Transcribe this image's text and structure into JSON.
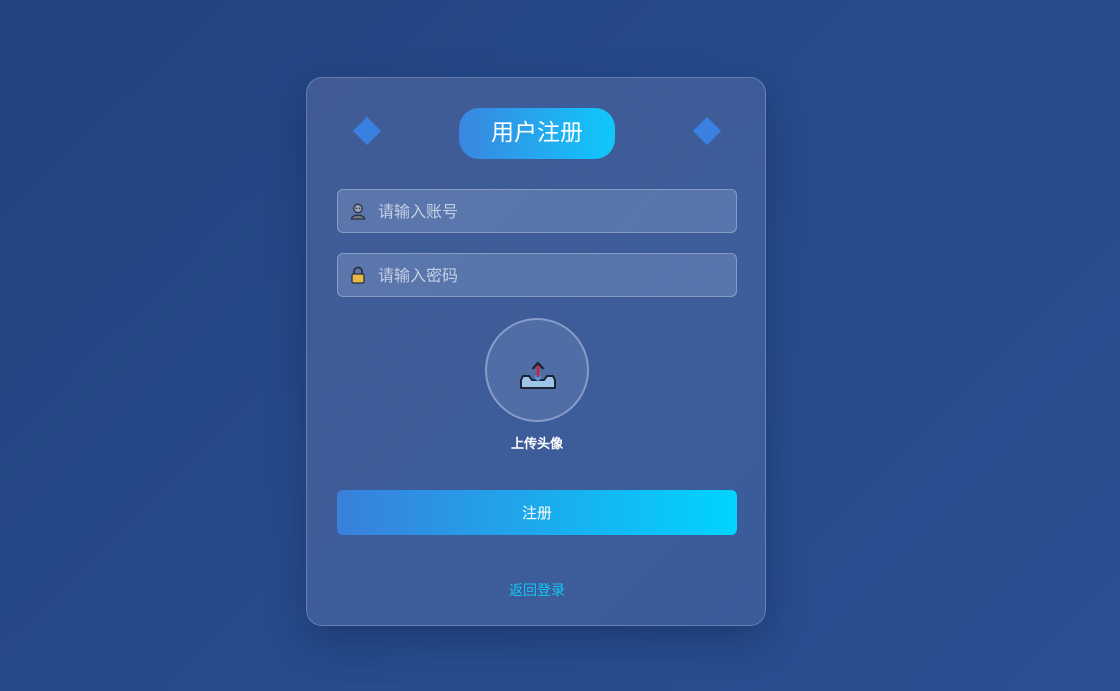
{
  "form": {
    "title": "用户注册",
    "account_placeholder": "请输入账号",
    "password_placeholder": "请输入密码",
    "upload_label": "上传头像",
    "register_label": "注册",
    "back_link": "返回登录"
  },
  "icons": {
    "account": "user-icon",
    "password": "lock-icon",
    "upload": "upload-icon",
    "decor": "diamond-icon"
  },
  "colors": {
    "accent_start": "#3a7fdb",
    "accent_end": "#00d4ff",
    "link": "#14c8f5",
    "background": "#244685"
  }
}
